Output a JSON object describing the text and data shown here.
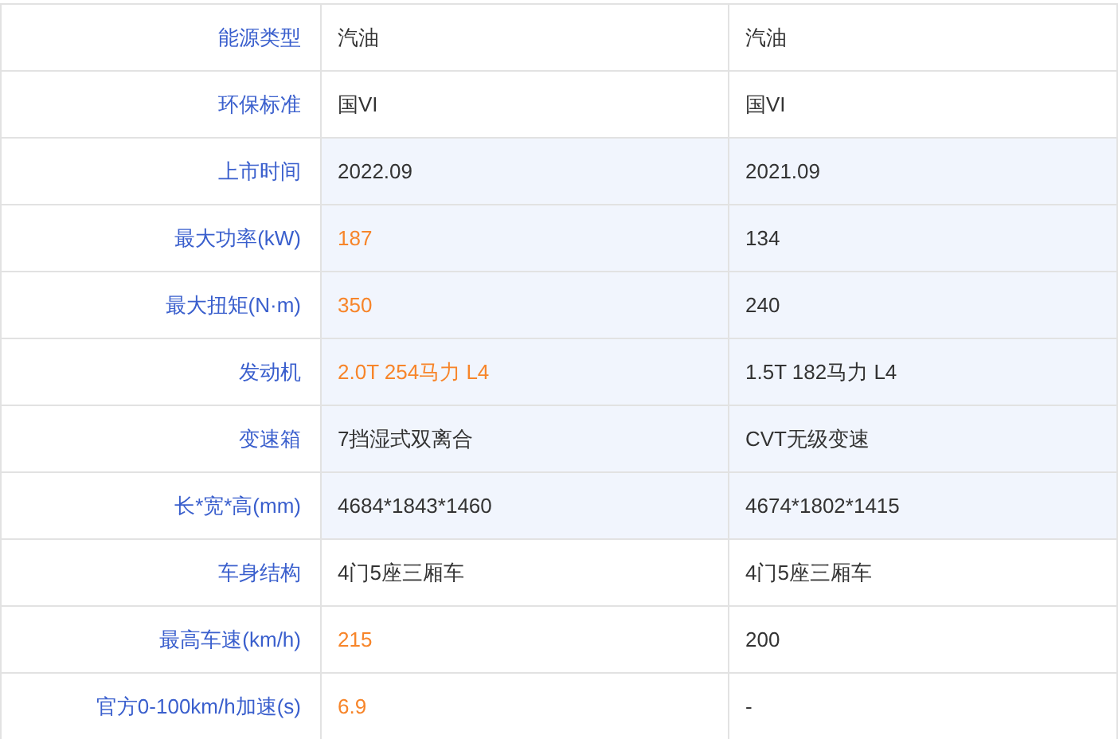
{
  "table": {
    "rows": [
      {
        "label": "能源类型",
        "highlighted": false,
        "cells": [
          {
            "text": "汽油",
            "emphasis": false
          },
          {
            "text": "汽油",
            "emphasis": false
          }
        ]
      },
      {
        "label": "环保标准",
        "highlighted": false,
        "cells": [
          {
            "text": "国VI",
            "emphasis": false
          },
          {
            "text": "国VI",
            "emphasis": false
          }
        ]
      },
      {
        "label": "上市时间",
        "highlighted": true,
        "cells": [
          {
            "text": "2022.09",
            "emphasis": false
          },
          {
            "text": "2021.09",
            "emphasis": false
          }
        ]
      },
      {
        "label": "最大功率(kW)",
        "highlighted": true,
        "cells": [
          {
            "text": "187",
            "emphasis": true
          },
          {
            "text": "134",
            "emphasis": false
          }
        ]
      },
      {
        "label": "最大扭矩(N·m)",
        "highlighted": true,
        "cells": [
          {
            "text": "350",
            "emphasis": true
          },
          {
            "text": "240",
            "emphasis": false
          }
        ]
      },
      {
        "label": "发动机",
        "highlighted": true,
        "cells": [
          {
            "text": "2.0T 254马力 L4",
            "emphasis": true
          },
          {
            "text": "1.5T 182马力 L4",
            "emphasis": false
          }
        ]
      },
      {
        "label": "变速箱",
        "highlighted": true,
        "cells": [
          {
            "text": "7挡湿式双离合",
            "emphasis": false
          },
          {
            "text": "CVT无级变速",
            "emphasis": false
          }
        ]
      },
      {
        "label": "长*宽*高(mm)",
        "highlighted": true,
        "cells": [
          {
            "text": "4684*1843*1460",
            "emphasis": false
          },
          {
            "text": "4674*1802*1415",
            "emphasis": false
          }
        ]
      },
      {
        "label": "车身结构",
        "highlighted": false,
        "cells": [
          {
            "text": "4门5座三厢车",
            "emphasis": false
          },
          {
            "text": "4门5座三厢车",
            "emphasis": false
          }
        ]
      },
      {
        "label": "最高车速(km/h)",
        "highlighted": false,
        "cells": [
          {
            "text": "215",
            "emphasis": true
          },
          {
            "text": "200",
            "emphasis": false
          }
        ]
      },
      {
        "label": "官方0-100km/h加速(s)",
        "highlighted": false,
        "cells": [
          {
            "text": "6.9",
            "emphasis": true
          },
          {
            "text": "-",
            "emphasis": false
          }
        ]
      }
    ]
  }
}
